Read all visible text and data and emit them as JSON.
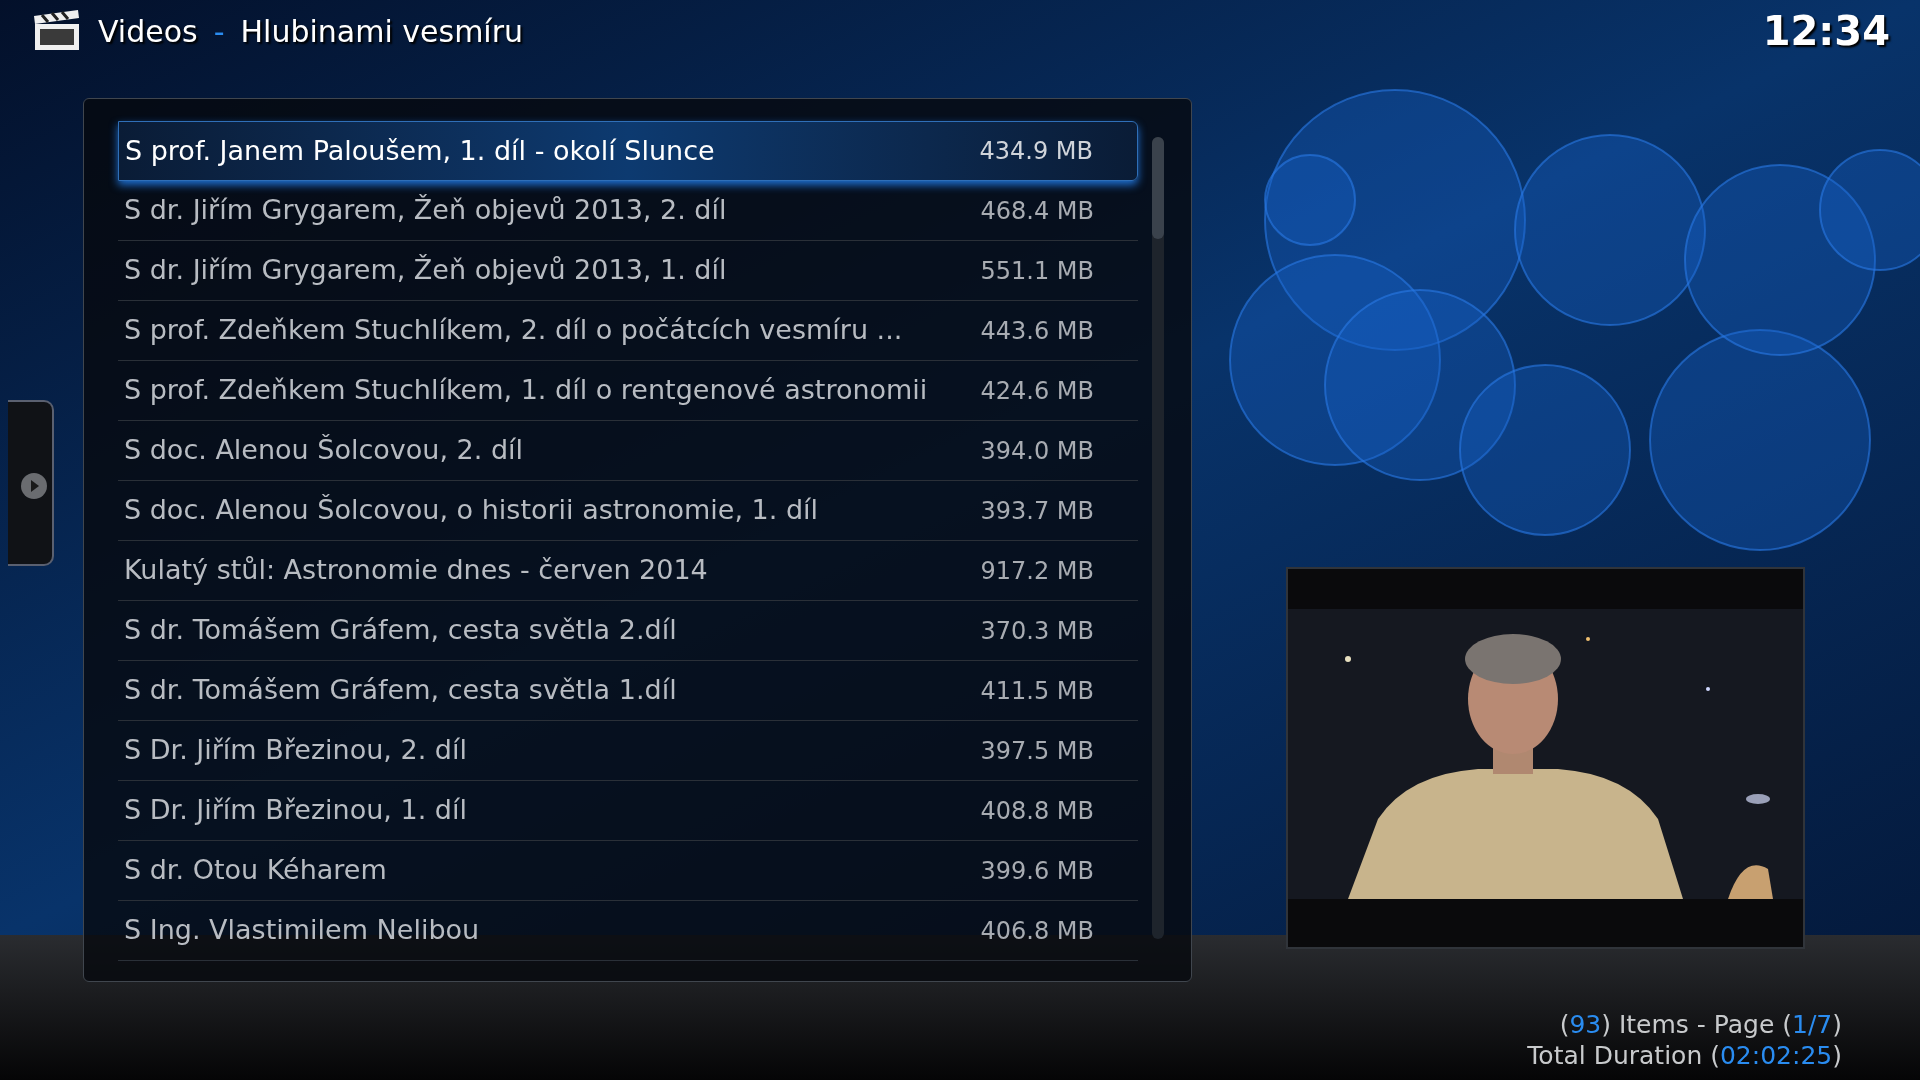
{
  "header": {
    "section": "Videos",
    "separator": "-",
    "title": "Hlubinami vesmíru"
  },
  "clock": "12:34",
  "list": [
    {
      "title": "S prof. Janem Paloušem, 1. díl - okolí Slunce",
      "size": "434.9 MB",
      "selected": true
    },
    {
      "title": "S dr. Jiřím Grygarem, Žeň objevů 2013, 2. díl",
      "size": "468.4 MB",
      "selected": false
    },
    {
      "title": "S dr. Jiřím Grygarem, Žeň objevů 2013, 1. díl",
      "size": "551.1 MB",
      "selected": false
    },
    {
      "title": "S prof. Zdeňkem Stuchlíkem, 2. díl o počátcích vesmíru ...",
      "size": "443.6 MB",
      "selected": false
    },
    {
      "title": "S prof. Zdeňkem Stuchlíkem, 1. díl o rentgenové astronomii",
      "size": "424.6 MB",
      "selected": false
    },
    {
      "title": "S doc. Alenou Šolcovou, 2. díl",
      "size": "394.0 MB",
      "selected": false
    },
    {
      "title": "S doc. Alenou Šolcovou, o historii astronomie, 1. díl",
      "size": "393.7 MB",
      "selected": false
    },
    {
      "title": "Kulatý stůl: Astronomie dnes - červen 2014",
      "size": "917.2 MB",
      "selected": false
    },
    {
      "title": "S dr. Tomášem Gráfem, cesta světla 2.díl",
      "size": "370.3 MB",
      "selected": false
    },
    {
      "title": "S dr. Tomášem Gráfem, cesta světla 1.díl",
      "size": "411.5 MB",
      "selected": false
    },
    {
      "title": "S Dr. Jiřím Březinou, 2. díl",
      "size": "397.5 MB",
      "selected": false
    },
    {
      "title": "S Dr. Jiřím Březinou, 1. díl",
      "size": "408.8 MB",
      "selected": false
    },
    {
      "title": "S dr. Otou Kéharem",
      "size": "399.6 MB",
      "selected": false
    },
    {
      "title": "S Ing. Vlastimilem Nelibou",
      "size": "406.8 MB",
      "selected": false
    }
  ],
  "status": [
    {
      "parts": [
        {
          "text": "(",
          "highlight": false
        },
        {
          "text": "93",
          "highlight": true
        },
        {
          "text": ") Items - Page (",
          "highlight": false
        },
        {
          "text": "1/7",
          "highlight": true
        },
        {
          "text": ")",
          "highlight": false
        }
      ]
    },
    {
      "parts": [
        {
          "text": "Total Duration (",
          "highlight": false
        },
        {
          "text": "02:02:25",
          "highlight": true
        },
        {
          "text": ")",
          "highlight": false
        }
      ]
    }
  ]
}
